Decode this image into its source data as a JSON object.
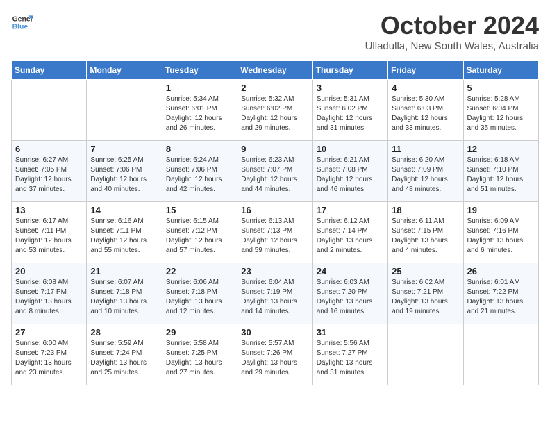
{
  "header": {
    "logo_general": "General",
    "logo_blue": "Blue",
    "month": "October 2024",
    "location": "Ulladulla, New South Wales, Australia"
  },
  "days_of_week": [
    "Sunday",
    "Monday",
    "Tuesday",
    "Wednesday",
    "Thursday",
    "Friday",
    "Saturday"
  ],
  "weeks": [
    [
      {
        "day": "",
        "content": ""
      },
      {
        "day": "",
        "content": ""
      },
      {
        "day": "1",
        "content": "Sunrise: 5:34 AM\nSunset: 6:01 PM\nDaylight: 12 hours\nand 26 minutes."
      },
      {
        "day": "2",
        "content": "Sunrise: 5:32 AM\nSunset: 6:02 PM\nDaylight: 12 hours\nand 29 minutes."
      },
      {
        "day": "3",
        "content": "Sunrise: 5:31 AM\nSunset: 6:02 PM\nDaylight: 12 hours\nand 31 minutes."
      },
      {
        "day": "4",
        "content": "Sunrise: 5:30 AM\nSunset: 6:03 PM\nDaylight: 12 hours\nand 33 minutes."
      },
      {
        "day": "5",
        "content": "Sunrise: 5:28 AM\nSunset: 6:04 PM\nDaylight: 12 hours\nand 35 minutes."
      }
    ],
    [
      {
        "day": "6",
        "content": "Sunrise: 6:27 AM\nSunset: 7:05 PM\nDaylight: 12 hours\nand 37 minutes."
      },
      {
        "day": "7",
        "content": "Sunrise: 6:25 AM\nSunset: 7:06 PM\nDaylight: 12 hours\nand 40 minutes."
      },
      {
        "day": "8",
        "content": "Sunrise: 6:24 AM\nSunset: 7:06 PM\nDaylight: 12 hours\nand 42 minutes."
      },
      {
        "day": "9",
        "content": "Sunrise: 6:23 AM\nSunset: 7:07 PM\nDaylight: 12 hours\nand 44 minutes."
      },
      {
        "day": "10",
        "content": "Sunrise: 6:21 AM\nSunset: 7:08 PM\nDaylight: 12 hours\nand 46 minutes."
      },
      {
        "day": "11",
        "content": "Sunrise: 6:20 AM\nSunset: 7:09 PM\nDaylight: 12 hours\nand 48 minutes."
      },
      {
        "day": "12",
        "content": "Sunrise: 6:18 AM\nSunset: 7:10 PM\nDaylight: 12 hours\nand 51 minutes."
      }
    ],
    [
      {
        "day": "13",
        "content": "Sunrise: 6:17 AM\nSunset: 7:11 PM\nDaylight: 12 hours\nand 53 minutes."
      },
      {
        "day": "14",
        "content": "Sunrise: 6:16 AM\nSunset: 7:11 PM\nDaylight: 12 hours\nand 55 minutes."
      },
      {
        "day": "15",
        "content": "Sunrise: 6:15 AM\nSunset: 7:12 PM\nDaylight: 12 hours\nand 57 minutes."
      },
      {
        "day": "16",
        "content": "Sunrise: 6:13 AM\nSunset: 7:13 PM\nDaylight: 12 hours\nand 59 minutes."
      },
      {
        "day": "17",
        "content": "Sunrise: 6:12 AM\nSunset: 7:14 PM\nDaylight: 13 hours\nand 2 minutes."
      },
      {
        "day": "18",
        "content": "Sunrise: 6:11 AM\nSunset: 7:15 PM\nDaylight: 13 hours\nand 4 minutes."
      },
      {
        "day": "19",
        "content": "Sunrise: 6:09 AM\nSunset: 7:16 PM\nDaylight: 13 hours\nand 6 minutes."
      }
    ],
    [
      {
        "day": "20",
        "content": "Sunrise: 6:08 AM\nSunset: 7:17 PM\nDaylight: 13 hours\nand 8 minutes."
      },
      {
        "day": "21",
        "content": "Sunrise: 6:07 AM\nSunset: 7:18 PM\nDaylight: 13 hours\nand 10 minutes."
      },
      {
        "day": "22",
        "content": "Sunrise: 6:06 AM\nSunset: 7:18 PM\nDaylight: 13 hours\nand 12 minutes."
      },
      {
        "day": "23",
        "content": "Sunrise: 6:04 AM\nSunset: 7:19 PM\nDaylight: 13 hours\nand 14 minutes."
      },
      {
        "day": "24",
        "content": "Sunrise: 6:03 AM\nSunset: 7:20 PM\nDaylight: 13 hours\nand 16 minutes."
      },
      {
        "day": "25",
        "content": "Sunrise: 6:02 AM\nSunset: 7:21 PM\nDaylight: 13 hours\nand 19 minutes."
      },
      {
        "day": "26",
        "content": "Sunrise: 6:01 AM\nSunset: 7:22 PM\nDaylight: 13 hours\nand 21 minutes."
      }
    ],
    [
      {
        "day": "27",
        "content": "Sunrise: 6:00 AM\nSunset: 7:23 PM\nDaylight: 13 hours\nand 23 minutes."
      },
      {
        "day": "28",
        "content": "Sunrise: 5:59 AM\nSunset: 7:24 PM\nDaylight: 13 hours\nand 25 minutes."
      },
      {
        "day": "29",
        "content": "Sunrise: 5:58 AM\nSunset: 7:25 PM\nDaylight: 13 hours\nand 27 minutes."
      },
      {
        "day": "30",
        "content": "Sunrise: 5:57 AM\nSunset: 7:26 PM\nDaylight: 13 hours\nand 29 minutes."
      },
      {
        "day": "31",
        "content": "Sunrise: 5:56 AM\nSunset: 7:27 PM\nDaylight: 13 hours\nand 31 minutes."
      },
      {
        "day": "",
        "content": ""
      },
      {
        "day": "",
        "content": ""
      }
    ]
  ]
}
